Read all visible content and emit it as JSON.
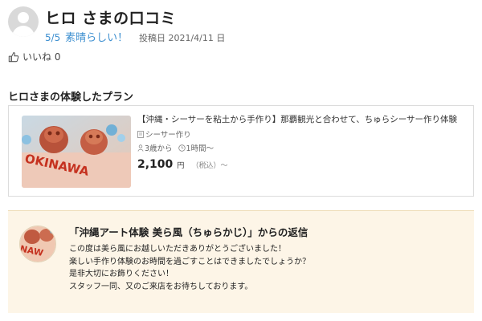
{
  "review": {
    "title": "ヒロ さまの口コミ",
    "rating": "5/5",
    "rating_label": "素晴らしい！",
    "posted_date": "投稿日 2021/4/11 日",
    "like_label": "いいね 0"
  },
  "plan_section": {
    "title": "ヒロさまの体験したプラン",
    "plan": {
      "image_text": "OKINAWA",
      "name": "【沖縄・シーサーを粘土から手作り】那覇観光と合わせて、ちゅらシーサー作り体験",
      "category": "シーサー作り",
      "age": "3歳から",
      "duration": "1時間～",
      "price": "2,100",
      "price_unit": "円",
      "price_tax": "（税込）～"
    }
  },
  "reply": {
    "title": "「沖縄アート体験 美ら風（ちゅらかじ）」からの返信",
    "lines": [
      "この度は美ら風にお越しいただきありがとうございました！",
      "楽しい手作り体験のお時間を過ごすことはできましたでしょうか？",
      "是非大切にお飾りください！",
      "スタッフ一同、又のご来店をお待ちしております。"
    ],
    "avatar_text": "NAW"
  },
  "colors": {
    "accent": "#3d8fd0",
    "reply_bg": "#fdf5e7",
    "card_border": "#dcdcdc"
  }
}
